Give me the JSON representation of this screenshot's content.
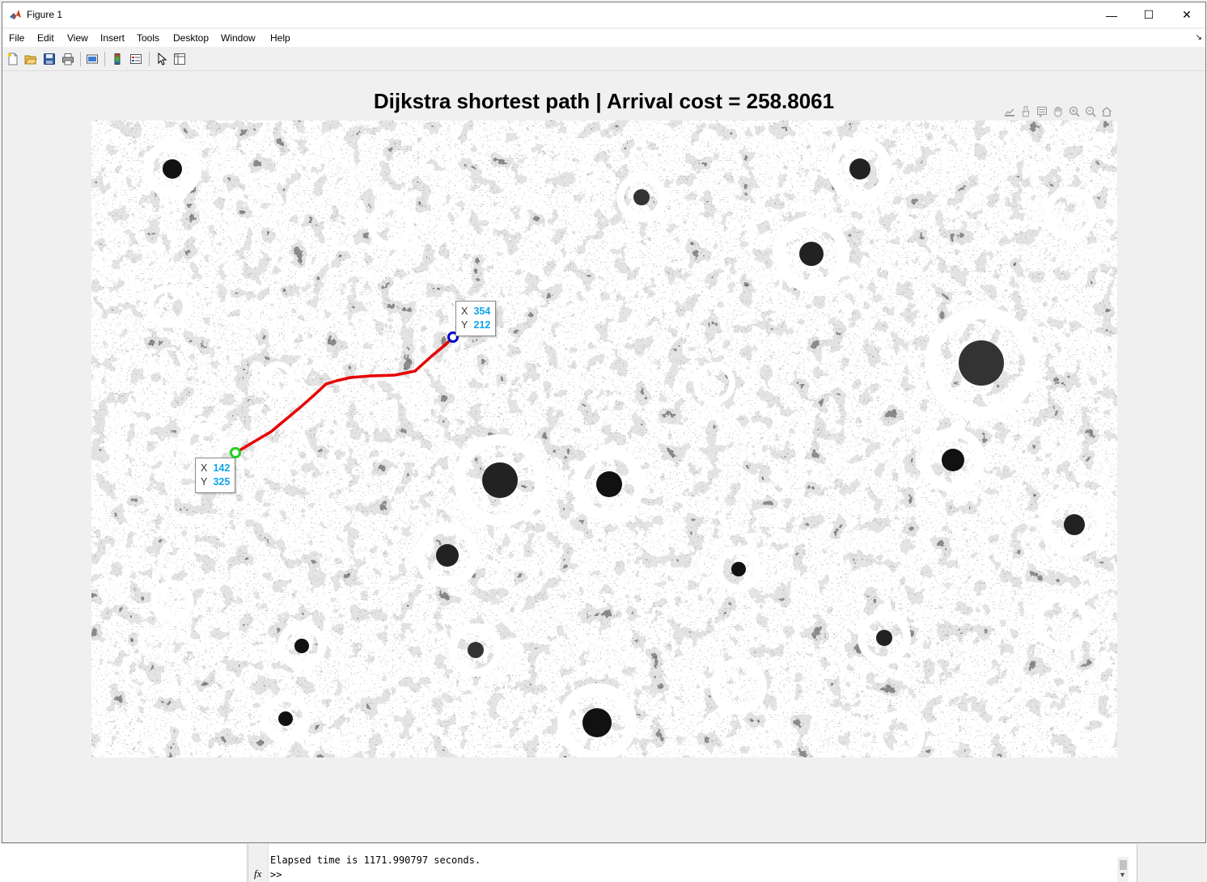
{
  "window": {
    "title": "Figure 1",
    "minimize_glyph": "—",
    "maximize_glyph": "☐",
    "close_glyph": "✕",
    "icon": "matlab-logo-icon"
  },
  "menubar": {
    "items": [
      "File",
      "Edit",
      "View",
      "Insert",
      "Tools",
      "Desktop",
      "Window",
      "Help"
    ],
    "dock_arrow": "↘"
  },
  "toolbar": {
    "buttons": [
      "new-figure-icon",
      "open-file-icon",
      "save-icon",
      "print-icon",
      "link-plot-icon",
      "insert-colorbar-icon",
      "insert-legend-icon",
      "edit-plot-arrow-icon",
      "property-inspector-icon"
    ]
  },
  "axes_toolbar": {
    "buttons": [
      "export-icon",
      "brush-icon",
      "datatip-icon",
      "pan-icon",
      "zoom-in-icon",
      "zoom-out-icon",
      "restore-view-icon"
    ]
  },
  "plot": {
    "title": "Dijkstra shortest path | Arrival cost = 258.8061",
    "path_color": "#e60000",
    "start_marker_color": "#1fd21f",
    "end_marker_color": "#0000cc",
    "datatip_value_color": "#0ea5e9"
  },
  "datatips": {
    "end": {
      "x_label": "X",
      "x_value": "354",
      "y_label": "Y",
      "y_value": "212"
    },
    "start": {
      "x_label": "X",
      "x_value": "142",
      "y_label": "Y",
      "y_value": "325"
    }
  },
  "command_window": {
    "output_line": "Elapsed time is 1171.990797 seconds.",
    "fx_glyph": "fx",
    "prompt": ">>"
  }
}
